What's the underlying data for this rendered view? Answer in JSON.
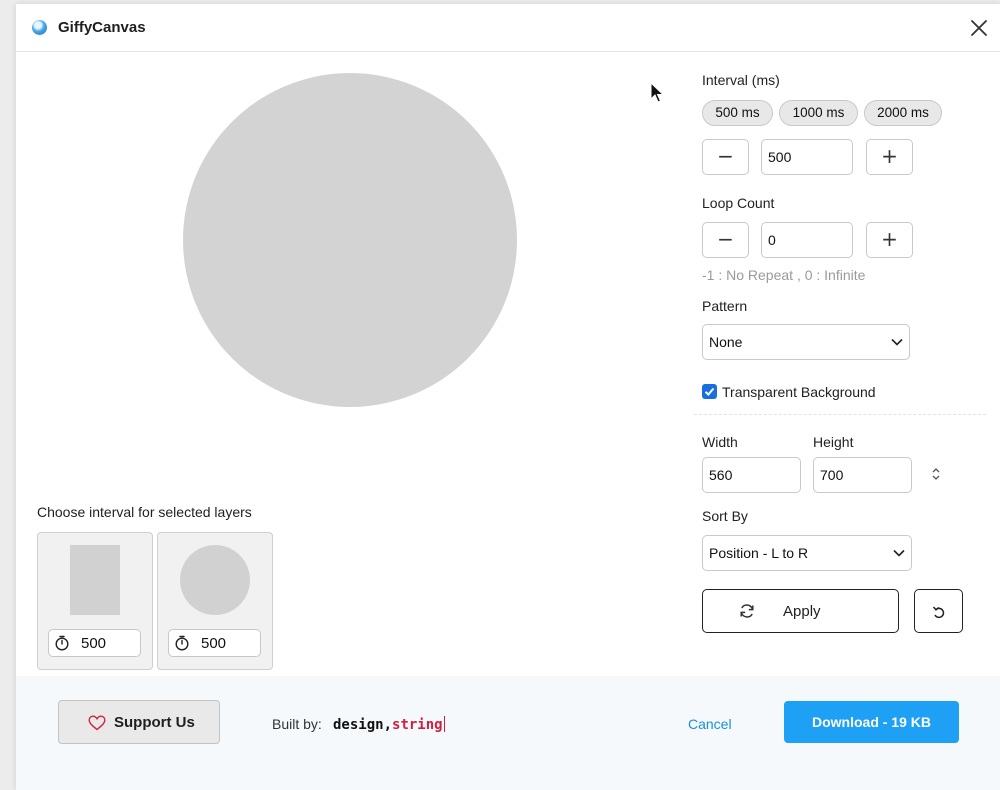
{
  "window": {
    "title": "GiffyCanvas",
    "close_icon": "close-icon",
    "app_icon": "giffycanvas-logo-icon"
  },
  "preview": {
    "shape": "circle",
    "fill": "#d3d3d3"
  },
  "layers": {
    "label": "Choose interval for selected layers",
    "items": [
      {
        "thumbnail": "rectangle",
        "interval": "500"
      },
      {
        "thumbnail": "circle",
        "interval": "500"
      }
    ]
  },
  "settings": {
    "interval": {
      "label": "Interval (ms)",
      "presets": [
        "500 ms",
        "1000 ms",
        "2000 ms"
      ],
      "value": "500",
      "decrement": "−",
      "increment": "+"
    },
    "loop": {
      "label": "Loop Count",
      "value": "0",
      "decrement": "−",
      "increment": "+",
      "hint": "-1 : No Repeat , 0 : Infinite"
    },
    "pattern": {
      "label": "Pattern",
      "selected": "None"
    },
    "transparent_background": {
      "label": "Transparent Background",
      "checked": true
    },
    "width": {
      "label": "Width",
      "value": "560"
    },
    "height": {
      "label": "Height",
      "value": "700"
    },
    "sort_by": {
      "label": "Sort By",
      "selected": "Position - L to R"
    },
    "apply_label": "Apply"
  },
  "footer": {
    "support_label": "Support Us",
    "built_by_label": "Built by:",
    "brand_part1": "design,",
    "brand_part2": "string",
    "cancel_label": "Cancel",
    "download_label": "Download - 19 KB"
  },
  "colors": {
    "accent": "#1ea0f5",
    "link": "#1a8fe0",
    "checkbox": "#1a6fe0",
    "brand_red": "#d0203f"
  }
}
